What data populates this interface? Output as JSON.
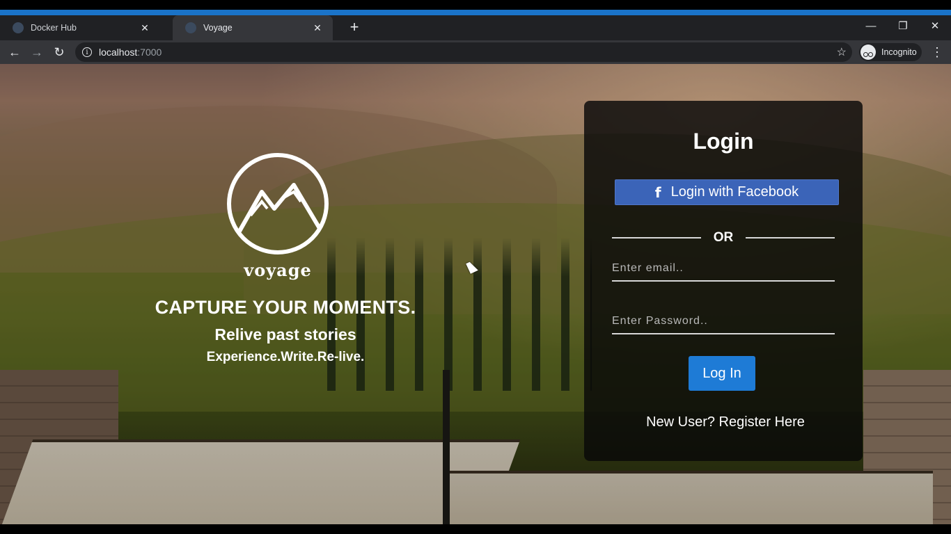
{
  "browser": {
    "tabs": [
      {
        "title": "Docker Hub",
        "active": false
      },
      {
        "title": "Voyage",
        "active": true
      }
    ],
    "new_tab_icon": "plus-icon",
    "url_host": "localhost",
    "url_port": ":7000",
    "profile_label": "Incognito",
    "accent_color": "#1a73c8"
  },
  "hero": {
    "brand": "voyage",
    "headline": "CAPTURE YOUR MOMENTS.",
    "tagline": "Relive past stories",
    "motto": "Experience.Write.Re-live."
  },
  "login": {
    "title": "Login",
    "facebook_label": "Login with Facebook",
    "facebook_icon": "f",
    "or_text": "OR",
    "email_placeholder": "Enter email..",
    "password_placeholder": "Enter Password..",
    "submit_label": "Log In",
    "register_text": "New User? Register Here",
    "facebook_color": "#3b64b8",
    "button_color": "#1e7bd6"
  }
}
